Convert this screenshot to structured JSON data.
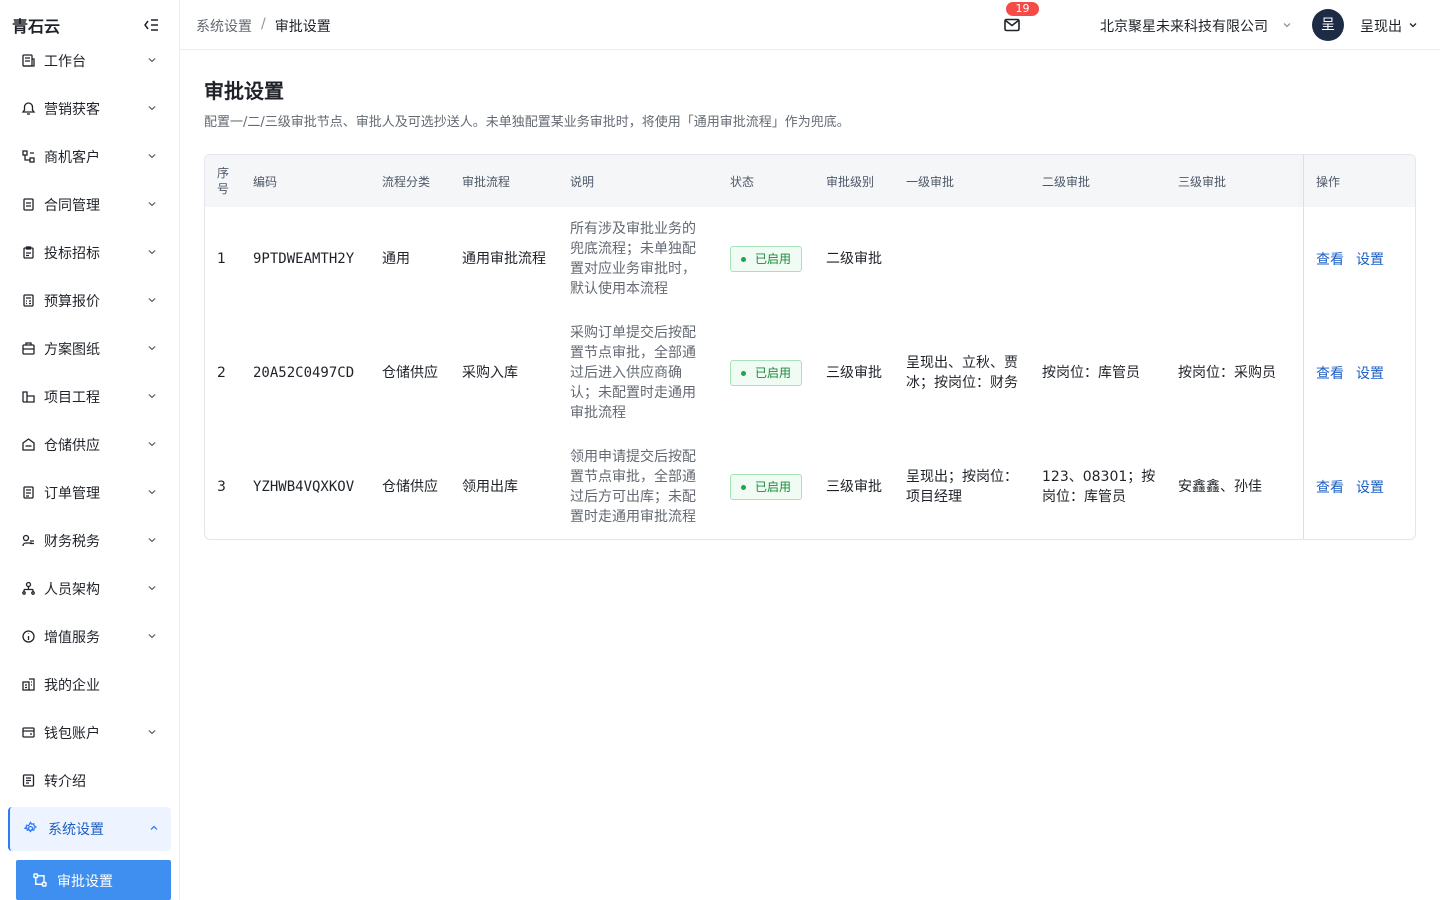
{
  "app": {
    "brand": "青石云"
  },
  "sidebar": {
    "items": [
      {
        "label": "工作台",
        "icon": "dashboard-icon",
        "has_children": true
      },
      {
        "label": "营销获客",
        "icon": "marketing-icon",
        "has_children": true
      },
      {
        "label": "商机客户",
        "icon": "customer-icon",
        "has_children": true
      },
      {
        "label": "合同管理",
        "icon": "contract-icon",
        "has_children": true
      },
      {
        "label": "投标招标",
        "icon": "bid-icon",
        "has_children": true
      },
      {
        "label": "预算报价",
        "icon": "budget-icon",
        "has_children": true
      },
      {
        "label": "方案图纸",
        "icon": "blueprint-icon",
        "has_children": true
      },
      {
        "label": "项目工程",
        "icon": "project-icon",
        "has_children": true
      },
      {
        "label": "仓储供应",
        "icon": "warehouse-icon",
        "has_children": true
      },
      {
        "label": "订单管理",
        "icon": "order-icon",
        "has_children": true
      },
      {
        "label": "财务税务",
        "icon": "finance-icon",
        "has_children": true
      },
      {
        "label": "人员架构",
        "icon": "org-icon",
        "has_children": true
      },
      {
        "label": "增值服务",
        "icon": "info-icon",
        "has_children": true
      },
      {
        "label": "我的企业",
        "icon": "enterprise-icon",
        "has_children": false
      },
      {
        "label": "钱包账户",
        "icon": "wallet-icon",
        "has_children": true
      },
      {
        "label": "转介绍",
        "icon": "referral-icon",
        "has_children": false
      },
      {
        "label": "系统设置",
        "icon": "gear-icon",
        "has_children": true,
        "expanded": true
      }
    ],
    "active_sub": {
      "label": "审批设置",
      "icon": "approval-flow-icon"
    }
  },
  "header": {
    "breadcrumb_parent": "系统设置",
    "breadcrumb_sep": "/",
    "breadcrumb_current": "审批设置",
    "mail_count": "19",
    "company": "北京聚星未来科技有限公司",
    "avatar_text": "呈",
    "username": "呈现出"
  },
  "main": {
    "title": "审批设置",
    "description": "配置一/二/三级审批节点、审批人及可选抄送人。未单独配置某业务审批时，将使用「通用审批流程」作为兜底。"
  },
  "table": {
    "columns": {
      "index": "序号",
      "code": "编码",
      "category": "流程分类",
      "flow": "审批流程",
      "desc": "说明",
      "status": "状态",
      "level": "审批级别",
      "l1": "一级审批",
      "l2": "二级审批",
      "l3": "三级审批",
      "ops": "操作"
    },
    "rows": [
      {
        "index": "1",
        "code": "9PTDWEAMTH2Y",
        "category": "通用",
        "flow": "通用审批流程",
        "desc": "所有涉及审批业务的兜底流程；未单独配置对应业务审批时，默认使用本流程",
        "status": "已启用",
        "level": "二级审批",
        "l1": "",
        "l2": "",
        "l3": "",
        "view": "查看",
        "setting": "设置"
      },
      {
        "index": "2",
        "code": "20A52C0497CD",
        "category": "仓储供应",
        "flow": "采购入库",
        "desc": "采购订单提交后按配置节点审批，全部通过后进入供应商确认；未配置时走通用审批流程",
        "status": "已启用",
        "level": "三级审批",
        "l1": "呈现出、立秋、贾冰；按岗位：财务",
        "l2": "按岗位：库管员",
        "l3": "按岗位：采购员",
        "view": "查看",
        "setting": "设置"
      },
      {
        "index": "3",
        "code": "YZHWB4VQXKOV",
        "category": "仓储供应",
        "flow": "领用出库",
        "desc": "领用申请提交后按配置节点审批，全部通过后方可出库；未配置时走通用审批流程",
        "status": "已启用",
        "level": "三级审批",
        "l1": "呈现出；按岗位：项目经理",
        "l2": "123、08301；按岗位：库管员",
        "l3": "安鑫鑫、孙佳",
        "view": "查看",
        "setting": "设置"
      }
    ]
  },
  "colors": {
    "accent": "#2f7bf6",
    "link": "#1d5fc4",
    "status_green": "#1a8a3b",
    "badge_red": "#f54a45"
  }
}
